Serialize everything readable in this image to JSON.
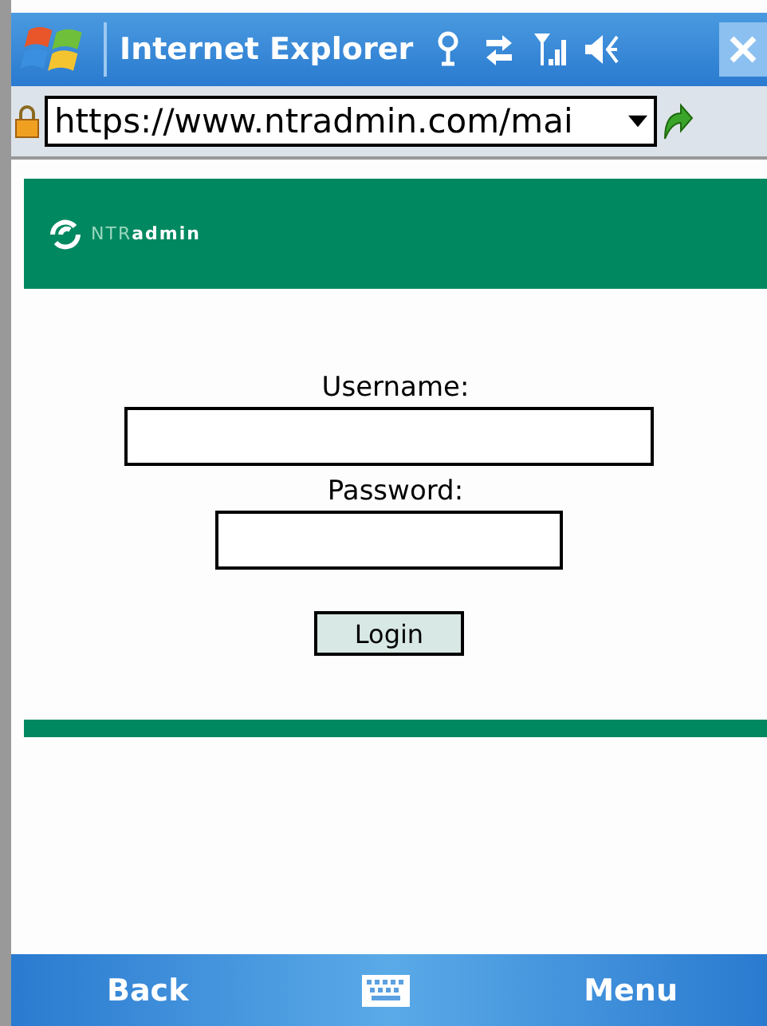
{
  "window": {
    "title": "Internet Explorer"
  },
  "address_bar": {
    "value": "https://www.ntradmin.com/mai"
  },
  "header": {
    "logo_text": "NTR**admin**"
  },
  "login_form": {
    "username_label": "Username:",
    "password_label": "Password:",
    "button": "Login"
  },
  "softkeys": {
    "left": "Back",
    "right": "Menu"
  }
}
